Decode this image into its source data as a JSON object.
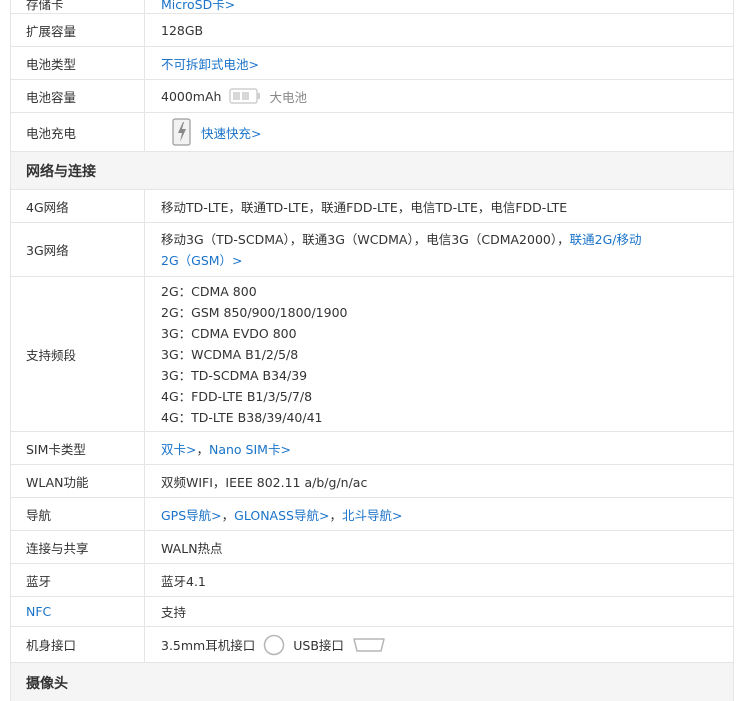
{
  "cut_row": {
    "label": "存储卡",
    "value": "MicroSD卡>"
  },
  "battery": {
    "expand_label": "扩展容量",
    "expand_value": "128GB",
    "type_label": "电池类型",
    "type_value": "不可拆卸式电池>",
    "capacity_label": "电池容量",
    "capacity_value": "4000mAh",
    "capacity_tag": "大电池",
    "charge_label": "电池充电",
    "charge_value": "快速快充>"
  },
  "network": {
    "section_title": "网络与连接",
    "lte_label": "4G网络",
    "lte_value": "移动TD-LTE，联通TD-LTE，联通FDD-LTE，电信TD-LTE，电信FDD-LTE",
    "g3_label": "3G网络",
    "g3_value_line1": "移动3G（TD-SCDMA），联通3G（WCDMA），电信3G（CDMA2000），",
    "g3_link_part1": "联通2G/移动",
    "g3_link_part2": "2G（GSM）>",
    "bands_label": "支持频段",
    "bands": [
      "2G：CDMA 800",
      "2G：GSM 850/900/1800/1900",
      "3G：CDMA EVDO 800",
      "3G：WCDMA B1/2/5/8",
      "3G：TD-SCDMA B34/39",
      "4G：FDD-LTE B1/3/5/7/8",
      "4G：TD-LTE B38/39/40/41"
    ],
    "sim_label": "SIM卡类型",
    "sim_link1": "双卡>",
    "sim_sep": "，",
    "sim_link2": "Nano SIM卡>",
    "wlan_label": "WLAN功能",
    "wlan_value": "双频WIFI，IEEE 802.11 a/b/g/n/ac",
    "nav_label": "导航",
    "nav_link1": "GPS导航>",
    "nav_sep1": "，",
    "nav_link2": "GLONASS导航>",
    "nav_sep2": "，",
    "nav_link3": "北斗导航>",
    "share_label": "连接与共享",
    "share_value": "WALN热点",
    "bt_label": "蓝牙",
    "bt_value": "蓝牙4.1",
    "nfc_label": "NFC",
    "nfc_value": "支持",
    "port_label": "机身接口",
    "port_audio": "3.5mm耳机接口",
    "port_usb": "USB接口"
  },
  "camera": {
    "section_title": "摄像头"
  },
  "colors": {
    "link": "#1a73c9",
    "border": "#e5e5e5",
    "section_bg": "#f5f5f5",
    "text": "#333333"
  },
  "icons": [
    "battery-icon",
    "fast-charge-icon",
    "headphone-jack-icon",
    "usb-port-icon",
    "watermark-logo"
  ]
}
